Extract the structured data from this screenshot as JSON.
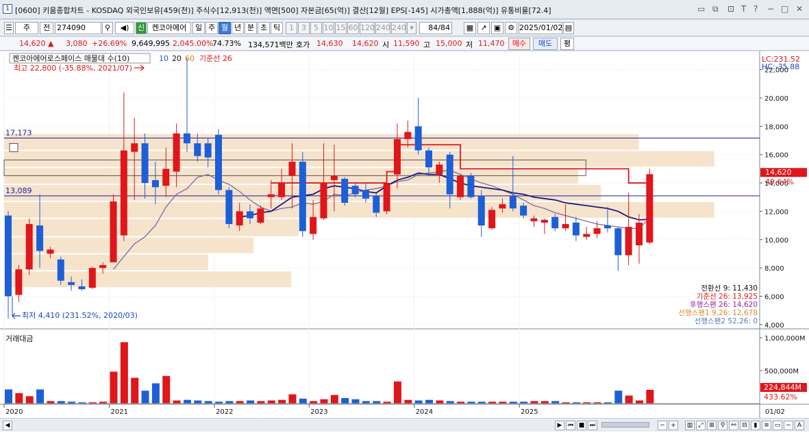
{
  "window": {
    "number": "1",
    "title": "[0600] 키움종합차트 - KOSDAQ 외국인보유[459(천)] 주식수[12,913(천)] 액면[500] 자본금[65(억)] 결산[12월] EPS[-145] 시가총액[1,888(억)] 유통비율[72.4]"
  },
  "toolbar": {
    "market": "주",
    "market2": "전",
    "code": "274090",
    "stock_name": "켄코아에어",
    "period_tabs": [
      "일",
      "주",
      "월",
      "년",
      "분",
      "초",
      "틱"
    ],
    "selected_period": "월",
    "intervals": [
      "1",
      "3",
      "5",
      "10",
      "15",
      "60",
      "120",
      "240",
      "240"
    ],
    "page_count": "84",
    "page_total": "/84",
    "date": "2025/01/02"
  },
  "quote": {
    "price": "14,620",
    "change": "3,080",
    "change_pct": "+26.69%",
    "volume": "9,649,995",
    "volume_pct": "2,045.00%",
    "turnover": "74.73%",
    "amount": "134,571백만",
    "ask_label": "호가",
    "ask": "14,630",
    "bid": "14,620",
    "open_label": "시",
    "open": "11,590",
    "high_label": "고",
    "high": "15,000",
    "low_label": "저",
    "low": "11,470",
    "buy_label": "매수",
    "sell_label": "매도",
    "eval_label": "평"
  },
  "chart_legend": {
    "series_title": "켄코아에어로스페이스 매물대 수(10)",
    "ma10": "10",
    "ma20": "20",
    "ma60": "60",
    "kijun": "기준선 26"
  },
  "annotations": {
    "highest": "최고 22,800 (-35.88%, 2021/07)",
    "lowest": "최저 4,410 (231.52%, 2020/03)",
    "line1_label": "17,173",
    "line2_label": "13,089",
    "lc": "LC:231.52",
    "hc": "HC:-35.88",
    "price_tag": "14,620",
    "price_tag_pct": "49.64%",
    "ichimoku": [
      "전환선 9: 11,430",
      "기준선 26: 13,925",
      "후행스팬 26: 14,620",
      "선행스팬1 9,26: 12,678",
      "선행스팬2 52,26: 0"
    ],
    "volume_panel_title": "거래대금",
    "vol_tag": "224,844M",
    "vol_tag_pct": "433.62%",
    "x_date_right": "01/02"
  },
  "colors": {
    "up": "#e0161a",
    "down": "#1d5fd6",
    "kijun": "#e0161a",
    "tenkan": "#1c1c7a",
    "lagging": "#7a6aa0",
    "volume_profile": "#f5e3cc",
    "hline": "#1c1c9c"
  },
  "chart_data": {
    "type": "candlestick",
    "y_axis_ticks": [
      "22,000",
      "20,000",
      "18,000",
      "16,000",
      "14,000",
      "12,000",
      "10,000",
      "8,000",
      "6,000",
      "4,000"
    ],
    "ylim": [
      3700,
      23000
    ],
    "year_labels": [
      "2020",
      "2021",
      "2022",
      "2023",
      "2024",
      "2025"
    ],
    "candles": [
      {
        "o": 11700,
        "h": 12000,
        "l": 4410,
        "c": 6000
      },
      {
        "o": 6100,
        "h": 8200,
        "l": 5600,
        "c": 7900
      },
      {
        "o": 7900,
        "h": 11500,
        "l": 7500,
        "c": 11100
      },
      {
        "o": 11000,
        "h": 13200,
        "l": 8000,
        "c": 9200
      },
      {
        "o": 9000,
        "h": 9500,
        "l": 8700,
        "c": 9300
      },
      {
        "o": 8600,
        "h": 8800,
        "l": 6800,
        "c": 7100
      },
      {
        "o": 7000,
        "h": 7400,
        "l": 6400,
        "c": 6800
      },
      {
        "o": 6700,
        "h": 7200,
        "l": 6400,
        "c": 6500
      },
      {
        "o": 6600,
        "h": 8100,
        "l": 6500,
        "c": 8000
      },
      {
        "o": 8000,
        "h": 8400,
        "l": 7600,
        "c": 8200
      },
      {
        "o": 8400,
        "h": 13200,
        "l": 8400,
        "c": 12700
      },
      {
        "o": 10300,
        "h": 20400,
        "l": 9900,
        "c": 16300
      },
      {
        "o": 16200,
        "h": 18600,
        "l": 12800,
        "c": 16800
      },
      {
        "o": 16800,
        "h": 17500,
        "l": 12900,
        "c": 14000
      },
      {
        "o": 14200,
        "h": 15500,
        "l": 12500,
        "c": 13700
      },
      {
        "o": 13800,
        "h": 16500,
        "l": 13000,
        "c": 15000
      },
      {
        "o": 14800,
        "h": 18200,
        "l": 13700,
        "c": 17500
      },
      {
        "o": 17500,
        "h": 22800,
        "l": 16200,
        "c": 16800
      },
      {
        "o": 16800,
        "h": 17500,
        "l": 15500,
        "c": 15900
      },
      {
        "o": 16800,
        "h": 17200,
        "l": 15100,
        "c": 15800
      },
      {
        "o": 17400,
        "h": 17800,
        "l": 13200,
        "c": 13500
      },
      {
        "o": 13500,
        "h": 13700,
        "l": 10800,
        "c": 11100
      },
      {
        "o": 11000,
        "h": 12600,
        "l": 10600,
        "c": 12000
      },
      {
        "o": 12000,
        "h": 12500,
        "l": 11100,
        "c": 11500
      },
      {
        "o": 11200,
        "h": 12400,
        "l": 11100,
        "c": 12200
      },
      {
        "o": 13000,
        "h": 14200,
        "l": 12200,
        "c": 13200
      },
      {
        "o": 13000,
        "h": 15000,
        "l": 12800,
        "c": 14000
      },
      {
        "o": 14500,
        "h": 16800,
        "l": 12200,
        "c": 15500
      },
      {
        "o": 15500,
        "h": 16200,
        "l": 10200,
        "c": 10600
      },
      {
        "o": 10400,
        "h": 12800,
        "l": 10000,
        "c": 11600
      },
      {
        "o": 11500,
        "h": 16800,
        "l": 11400,
        "c": 14000
      },
      {
        "o": 14200,
        "h": 16700,
        "l": 12000,
        "c": 14500
      },
      {
        "o": 14300,
        "h": 14400,
        "l": 12400,
        "c": 12600
      },
      {
        "o": 13800,
        "h": 14000,
        "l": 13000,
        "c": 13200
      },
      {
        "o": 13500,
        "h": 14000,
        "l": 12600,
        "c": 12900
      },
      {
        "o": 13100,
        "h": 13300,
        "l": 11600,
        "c": 11900
      },
      {
        "o": 12000,
        "h": 14500,
        "l": 11800,
        "c": 14000
      },
      {
        "o": 14600,
        "h": 18200,
        "l": 13600,
        "c": 17100
      },
      {
        "o": 17100,
        "h": 18400,
        "l": 16500,
        "c": 17600
      },
      {
        "o": 18000,
        "h": 20000,
        "l": 16000,
        "c": 16300
      },
      {
        "o": 16300,
        "h": 16500,
        "l": 14600,
        "c": 15100
      },
      {
        "o": 14600,
        "h": 15500,
        "l": 14000,
        "c": 15300
      },
      {
        "o": 16000,
        "h": 16200,
        "l": 12200,
        "c": 13200
      },
      {
        "o": 13000,
        "h": 14600,
        "l": 12800,
        "c": 14500
      },
      {
        "o": 14500,
        "h": 14700,
        "l": 12900,
        "c": 13000
      },
      {
        "o": 13100,
        "h": 13500,
        "l": 10200,
        "c": 11000
      },
      {
        "o": 10800,
        "h": 12300,
        "l": 10700,
        "c": 12100
      },
      {
        "o": 12200,
        "h": 12900,
        "l": 11900,
        "c": 12500
      },
      {
        "o": 13100,
        "h": 15900,
        "l": 12000,
        "c": 12200
      },
      {
        "o": 12400,
        "h": 12600,
        "l": 11500,
        "c": 11700
      },
      {
        "o": 11300,
        "h": 11700,
        "l": 10900,
        "c": 11500
      },
      {
        "o": 11200,
        "h": 11500,
        "l": 10400,
        "c": 11400
      },
      {
        "o": 11600,
        "h": 11800,
        "l": 10600,
        "c": 10800
      },
      {
        "o": 10800,
        "h": 12500,
        "l": 10600,
        "c": 11100
      },
      {
        "o": 11200,
        "h": 11600,
        "l": 9900,
        "c": 10300
      },
      {
        "o": 10200,
        "h": 10900,
        "l": 10000,
        "c": 10400
      },
      {
        "o": 10400,
        "h": 11300,
        "l": 10100,
        "c": 10800
      },
      {
        "o": 11000,
        "h": 12300,
        "l": 10500,
        "c": 10800
      },
      {
        "o": 10800,
        "h": 10900,
        "l": 7800,
        "c": 8900
      },
      {
        "o": 8900,
        "h": 13300,
        "l": 8200,
        "c": 10900
      },
      {
        "o": 9600,
        "h": 11800,
        "l": 8300,
        "c": 11200
      },
      {
        "o": 9800,
        "h": 15000,
        "l": 9700,
        "c": 14620
      }
    ],
    "kijun_line": [
      null,
      null,
      null,
      null,
      null,
      null,
      null,
      null,
      null,
      null,
      null,
      null,
      null,
      null,
      null,
      null,
      null,
      null,
      null,
      null,
      null,
      null,
      null,
      null,
      null,
      14000,
      14000,
      14000,
      14000,
      14000,
      14000,
      14000,
      14000,
      14000,
      14000,
      14000,
      14800,
      16700,
      16700,
      16700,
      16700,
      16700,
      16700,
      15000,
      15000,
      15000,
      15000,
      15000,
      15000,
      15000,
      15000,
      15000,
      15000,
      15000,
      15000,
      15000,
      15000,
      15000,
      15000,
      14000,
      14000,
      14000
    ],
    "tenkan_line": [
      null,
      null,
      null,
      null,
      null,
      null,
      null,
      null,
      null,
      null,
      null,
      null,
      null,
      null,
      null,
      null,
      null,
      null,
      null,
      null,
      null,
      null,
      11600,
      11700,
      11900,
      12000,
      12500,
      13000,
      13100,
      13200,
      13600,
      13800,
      13700,
      13600,
      13400,
      13300,
      13800,
      14200,
      14400,
      14700,
      14600,
      14600,
      14300,
      14000,
      13800,
      13700,
      13600,
      13500,
      13300,
      13200,
      13000,
      12900,
      12800,
      12600,
      12500,
      12400,
      12300,
      12200,
      12000,
      11600,
      11400,
      11430
    ],
    "lagging_line": [
      null,
      null,
      null,
      null,
      null,
      null,
      null,
      null,
      null,
      null,
      7900,
      8800,
      9700,
      10200,
      11000,
      12300,
      13200,
      13600,
      14400,
      14600,
      14200,
      13900,
      13400,
      12800,
      12300,
      12000,
      12200,
      12300,
      12600,
      12500,
      12700,
      13200,
      13100,
      13300,
      13500,
      13600,
      13800,
      14100,
      14200,
      14600,
      14700,
      14800,
      14900,
      14600,
      14300,
      14000,
      13800,
      13500,
      13200,
      12800,
      12400,
      12200,
      11900,
      11700,
      11500,
      11300,
      11100,
      11000,
      10900,
      10800,
      10800,
      11500
    ],
    "volume_profile": [
      {
        "from": 16300,
        "to": 17500,
        "len": 0.84
      },
      {
        "from": 15100,
        "to": 16300,
        "len": 0.94
      },
      {
        "from": 13900,
        "to": 15100,
        "len": 0.76
      },
      {
        "from": 12700,
        "to": 13900,
        "len": 0.79
      },
      {
        "from": 11500,
        "to": 12700,
        "len": 0.94
      },
      {
        "from": 10200,
        "to": 11500,
        "len": 0.39
      },
      {
        "from": 9000,
        "to": 10200,
        "len": 0.33
      },
      {
        "from": 7800,
        "to": 9000,
        "len": 0.27
      },
      {
        "from": 6600,
        "to": 7800,
        "len": 0.38
      }
    ],
    "hlines": [
      17173,
      13089
    ],
    "volume_values": [
      230,
      170,
      120,
      230,
      40,
      40,
      30,
      20,
      20,
      30,
      520,
      1000,
      420,
      210,
      330,
      450,
      50,
      60,
      50,
      40,
      30,
      40,
      40,
      50,
      40,
      50,
      60,
      150,
      80,
      40,
      70,
      140,
      90,
      70,
      40,
      40,
      30,
      360,
      60,
      50,
      60,
      50,
      40,
      30,
      30,
      30,
      30,
      30,
      30,
      30,
      40,
      40,
      40,
      20,
      20,
      20,
      20,
      20,
      210,
      130,
      50,
      224
    ]
  },
  "volume_axis": [
    "1,000,000M",
    "500,000M"
  ]
}
